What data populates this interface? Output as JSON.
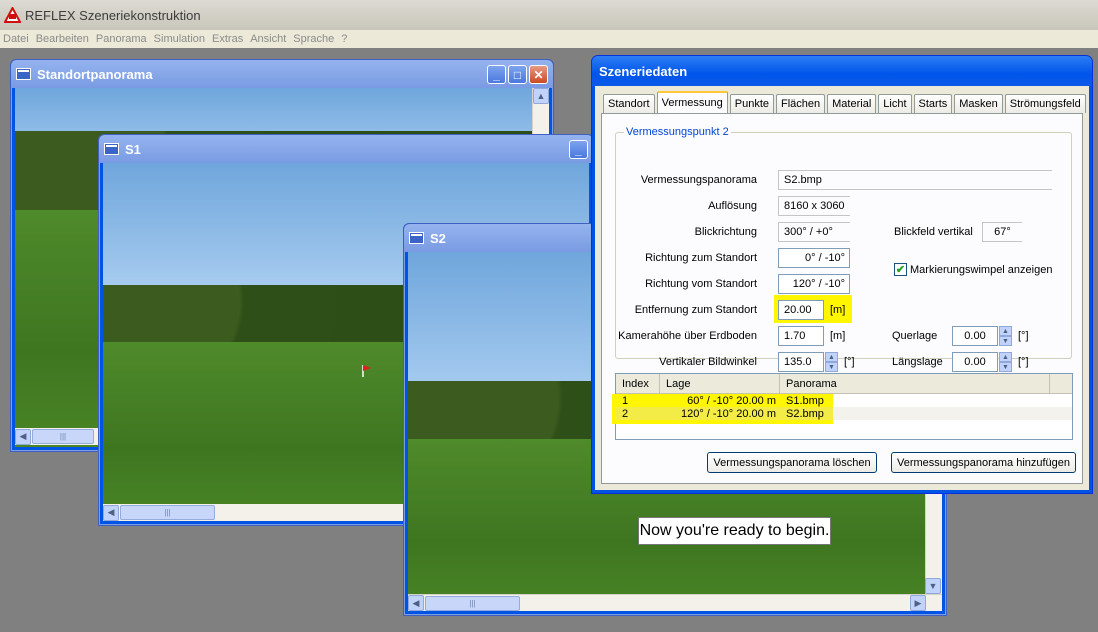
{
  "app": {
    "title": "REFLEX Szeneriekonstruktion"
  },
  "menu": [
    "Datei",
    "Bearbeiten",
    "Panorama",
    "Simulation",
    "Extras",
    "Ansicht",
    "Sprache",
    "?"
  ],
  "windows": {
    "standort": {
      "title": "Standortpanorama"
    },
    "s1": {
      "title": "S1"
    },
    "s2": {
      "title": "S2"
    }
  },
  "scroll_grip": "|||",
  "dialog": {
    "title": "Szeneriedaten",
    "tabs": [
      "Standort",
      "Vermessung",
      "Punkte",
      "Flächen",
      "Material",
      "Licht",
      "Starts",
      "Masken",
      "Strömungsfeld"
    ],
    "active_tab": "Vermessung",
    "group_title": "Vermessungspunkt 2",
    "fields": {
      "panorama_label": "Vermessungspanorama",
      "panorama_value": "S2.bmp",
      "aufloesung_label": "Auflösung",
      "aufloesung_value": "8160 x 3060",
      "blickrichtung_label": "Blickrichtung",
      "blickrichtung_value": "300° /   +0°",
      "blickfeld_label": "Blickfeld vertikal",
      "blickfeld_value": "67°",
      "richtung_zum_label": "Richtung zum Standort",
      "richtung_zum_value": "0° /  -10°",
      "richtung_vom_label": "Richtung vom Standort",
      "richtung_vom_value": "120° /  -10°",
      "markierung_label": "Markierungswimpel anzeigen",
      "entfernung_label": "Entfernung zum Standort",
      "entfernung_value": "20.00",
      "entfernung_unit": "[m]",
      "kamerahoehe_label": "Kamerahöhe über Erdboden",
      "kamerahoehe_value": "1.70",
      "kamerahoehe_unit": "[m]",
      "querlage_label": "Querlage",
      "querlage_value": "0.00",
      "querlage_unit": "[°]",
      "bildwinkel_label": "Vertikaler Bildwinkel",
      "bildwinkel_value": "135.0",
      "bildwinkel_unit": "[°]",
      "laengslage_label": "Längslage",
      "laengslage_value": "0.00",
      "laengslage_unit": "[°]"
    },
    "table": {
      "columns": [
        "Index",
        "Lage",
        "Panorama"
      ],
      "rows": [
        {
          "index": "1",
          "lage": "60° /  -10°    20.00 m",
          "panorama": "S1.bmp"
        },
        {
          "index": "2",
          "lage": "120° /  -10°    20.00 m",
          "panorama": "S2.bmp"
        }
      ]
    },
    "buttons": {
      "delete": "Vermessungspanorama löschen",
      "add": "Vermessungspanorama hinzufügen"
    }
  },
  "tooltip": "Now you're ready to begin.",
  "colors": {
    "highlight": "#fff600",
    "titlebar": "#0054e3",
    "inactive_titlebar": "#7a9be3"
  }
}
